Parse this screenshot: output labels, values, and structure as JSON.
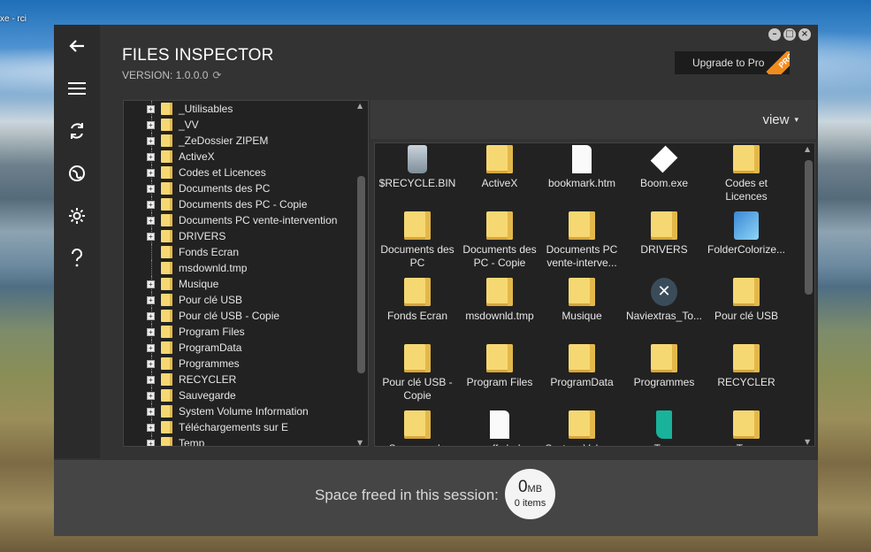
{
  "desktop": {
    "label": "xe -\nrci"
  },
  "window": {
    "title": "FILES INSPECTOR",
    "version": "VERSION: 1.0.0.0",
    "controls": [
      "minimize",
      "maximize",
      "close"
    ],
    "upgrade_label": "Upgrade to Pro",
    "pro_badge": "PRO"
  },
  "sidebar": {
    "items": [
      {
        "icon": "back-arrow-icon",
        "glyph": "←"
      },
      {
        "icon": "menu-icon",
        "glyph": "☰"
      },
      {
        "icon": "refresh-icon",
        "glyph": "⟳"
      },
      {
        "icon": "globe-icon",
        "glyph": "◍"
      },
      {
        "icon": "settings-icon",
        "glyph": "⚙"
      },
      {
        "icon": "help-icon",
        "glyph": "?"
      }
    ]
  },
  "tree": {
    "items": [
      {
        "label": "_Utilisables",
        "expandable": true
      },
      {
        "label": "_VV",
        "expandable": true
      },
      {
        "label": "_ZeDossier ZIPEM",
        "expandable": true
      },
      {
        "label": "ActiveX",
        "expandable": true
      },
      {
        "label": "Codes et Licences",
        "expandable": true
      },
      {
        "label": "Documents des PC",
        "expandable": true
      },
      {
        "label": "Documents des PC - Copie",
        "expandable": true
      },
      {
        "label": "Documents PC vente-intervention",
        "expandable": true
      },
      {
        "label": "DRIVERS",
        "expandable": true
      },
      {
        "label": "Fonds Ecran",
        "expandable": false
      },
      {
        "label": "msdownld.tmp",
        "expandable": false
      },
      {
        "label": "Musique",
        "expandable": true
      },
      {
        "label": "Pour clé USB",
        "expandable": true
      },
      {
        "label": "Pour clé USB - Copie",
        "expandable": true
      },
      {
        "label": "Program Files",
        "expandable": true
      },
      {
        "label": "ProgramData",
        "expandable": true
      },
      {
        "label": "Programmes",
        "expandable": true
      },
      {
        "label": "RECYCLER",
        "expandable": true
      },
      {
        "label": "Sauvegarde",
        "expandable": true
      },
      {
        "label": "System Volume Information",
        "expandable": true
      },
      {
        "label": "Téléchargements sur E",
        "expandable": true
      },
      {
        "label": "Temp",
        "expandable": true
      }
    ]
  },
  "view": {
    "label": "view",
    "caret": "▾"
  },
  "files": [
    {
      "label": "$RECYCLE.BIN",
      "type": "bin"
    },
    {
      "label": "ActiveX",
      "type": "folder"
    },
    {
      "label": "bookmark.htm",
      "type": "doc"
    },
    {
      "label": "Boom.exe",
      "type": "boom"
    },
    {
      "label": "Codes et Licences",
      "type": "folder"
    },
    {
      "label": "Documents des PC",
      "type": "folder"
    },
    {
      "label": "Documents des PC - Copie",
      "type": "folder"
    },
    {
      "label": "Documents PC vente-interve...",
      "type": "folder"
    },
    {
      "label": "DRIVERS",
      "type": "folder"
    },
    {
      "label": "FolderColorize...",
      "type": "colorize"
    },
    {
      "label": "Fonds Ecran",
      "type": "folder"
    },
    {
      "label": "msdownld.tmp",
      "type": "folder"
    },
    {
      "label": "Musique",
      "type": "folder"
    },
    {
      "label": "Naviextras_To...",
      "type": "navi"
    },
    {
      "label": "Pour clé USB",
      "type": "folder"
    },
    {
      "label": "Pour clé USB - Copie",
      "type": "folder"
    },
    {
      "label": "Program Files",
      "type": "folder"
    },
    {
      "label": "ProgramData",
      "type": "folder"
    },
    {
      "label": "Programmes",
      "type": "folder"
    },
    {
      "label": "RECYCLER",
      "type": "folder"
    },
    {
      "label": "Sauvegarde",
      "type": "folder"
    },
    {
      "label": "scoffc.bak",
      "type": "doc"
    },
    {
      "label": "System Volume Information",
      "type": "folder"
    },
    {
      "label": "Te...",
      "type": "teal"
    },
    {
      "label": "Te...",
      "type": "folder"
    }
  ],
  "footer": {
    "freed_label": "Space freed in this session:",
    "amount": "0",
    "unit": "MB",
    "items": "0 items"
  }
}
